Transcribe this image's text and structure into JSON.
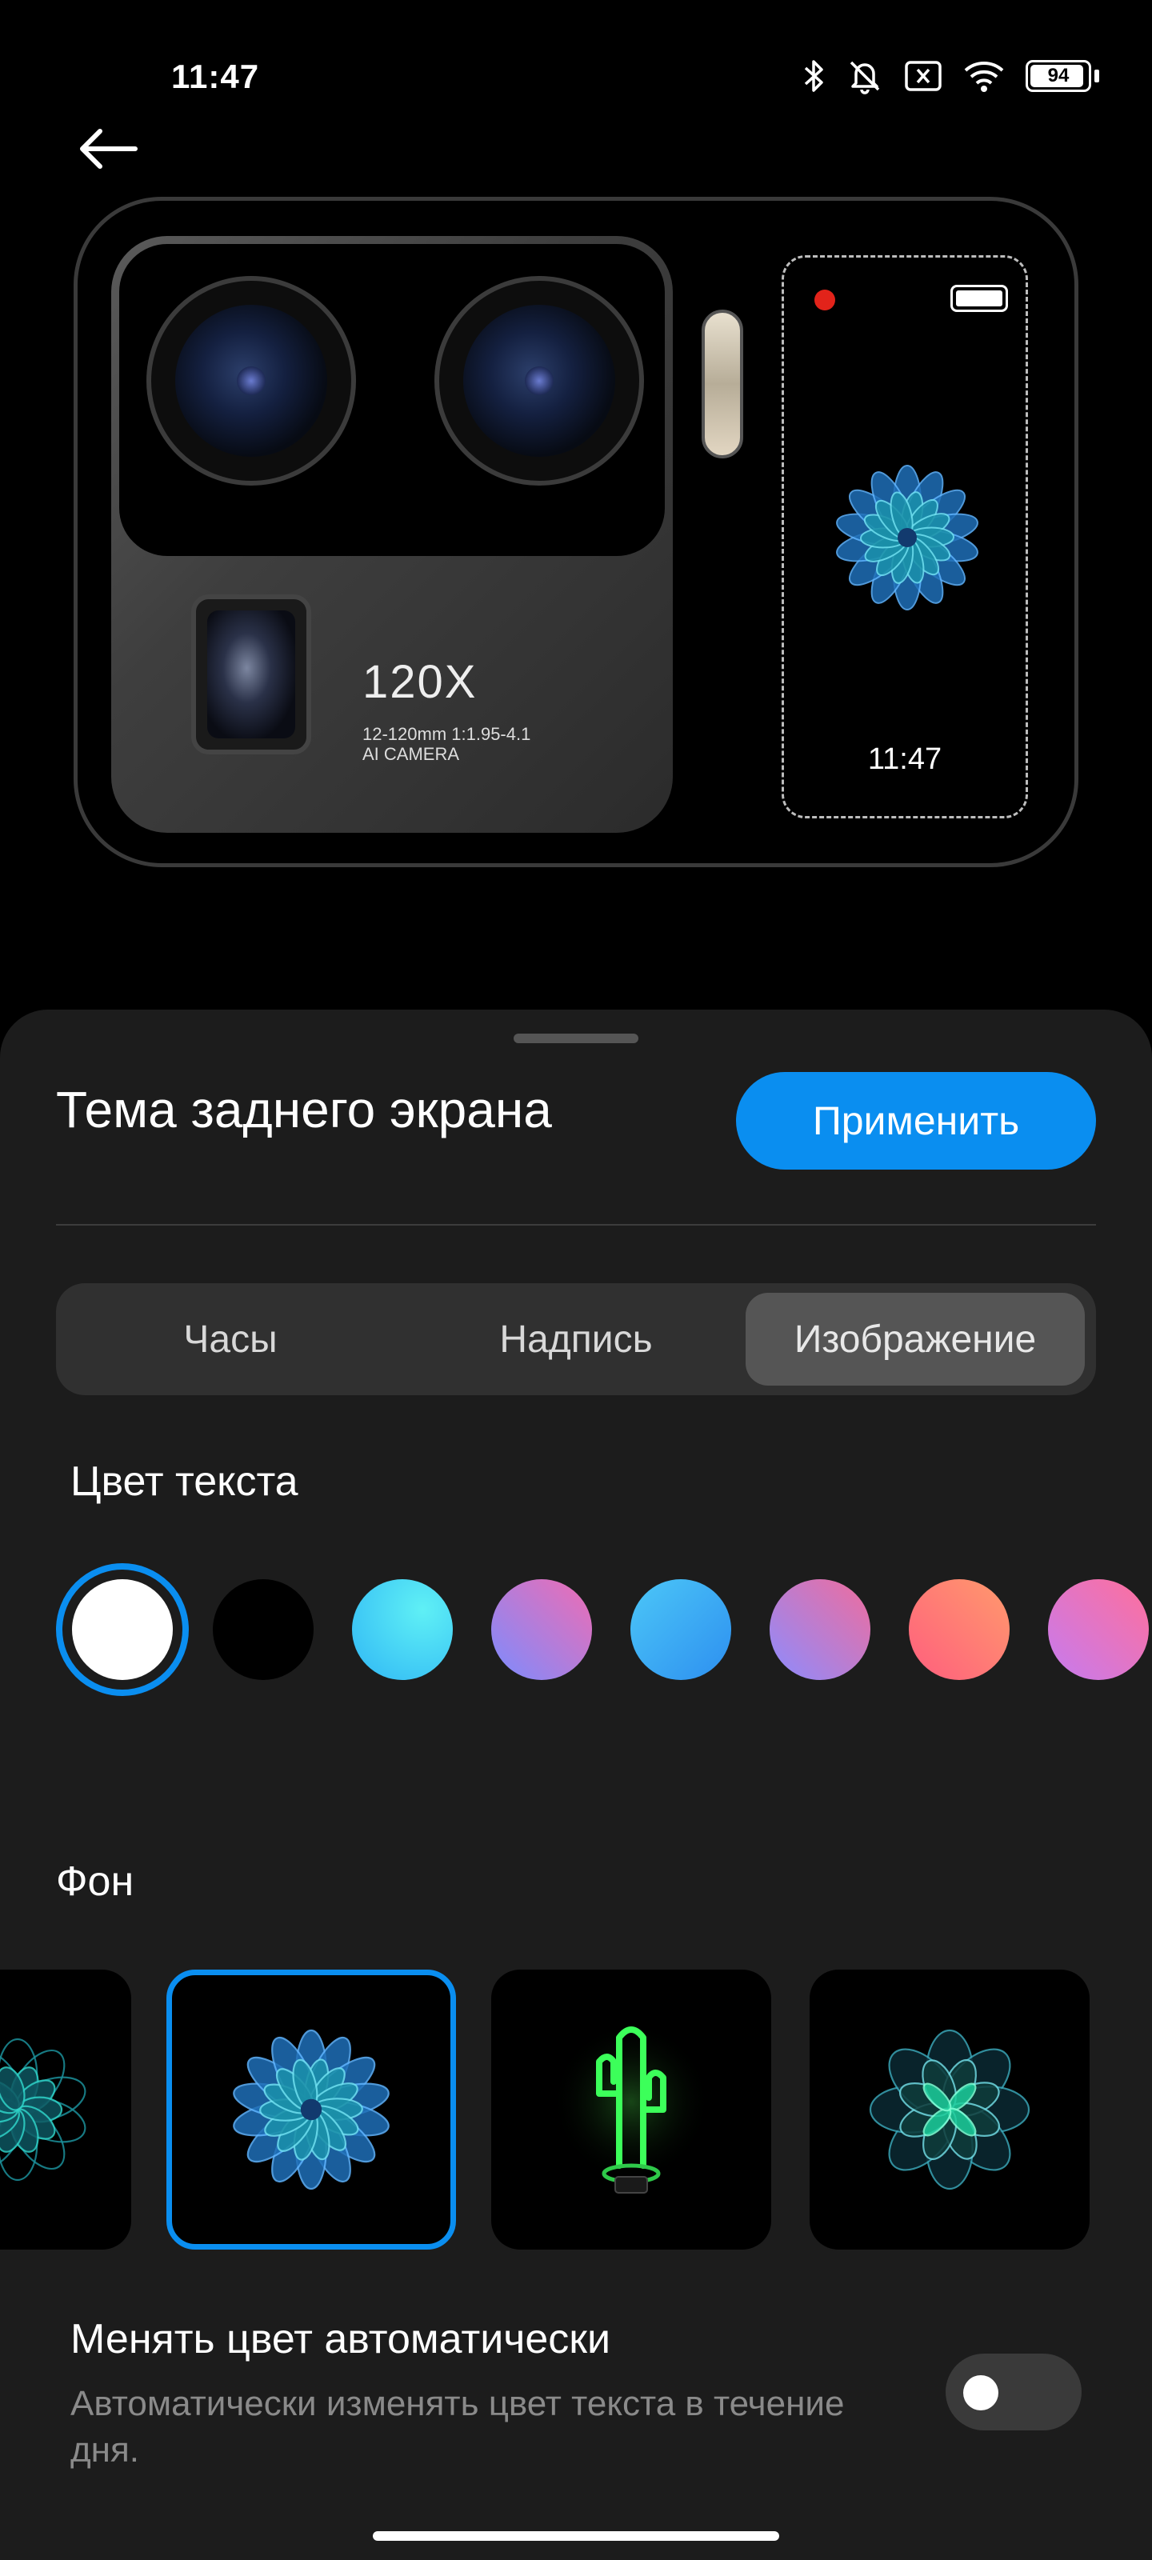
{
  "status_bar": {
    "time": "11:47",
    "icons": [
      "bluetooth-icon",
      "silent-bell-icon",
      "no-sim-icon",
      "wifi-icon",
      "battery-icon"
    ],
    "battery_level": "94",
    "battery_fraction": 0.94
  },
  "preview": {
    "camera_model": "120X",
    "camera_spec_line1": "12-120mm 1:1.95-4.1",
    "camera_spec_line2": "AI CAMERA",
    "rear_screen_time": "11:47"
  },
  "sheet": {
    "title": "Тема заднего экрана",
    "apply_label": "Применить",
    "tabs": [
      {
        "label": "Часы",
        "active": false
      },
      {
        "label": "Надпись",
        "active": false
      },
      {
        "label": "Изображение",
        "active": true
      }
    ],
    "text_color_label": "Цвет текста",
    "text_colors": [
      "#ffffff",
      "#000000",
      "#2fd3f5",
      "#b06ce8",
      "#2fb6f5",
      "#f06cb2",
      "#ff6f6f",
      "#e86ccd"
    ],
    "selected_text_color": "#ffffff",
    "background_label": "Фон",
    "backgrounds": [
      "mandala-teal",
      "flower-blue",
      "neon-cactus",
      "kaleidoscope-teal"
    ],
    "selected_background": "flower-blue",
    "auto_color_title": "Менять цвет автоматически",
    "auto_color_desc": "Автоматически изменять цвет текста в течение дня.",
    "auto_color_enabled": false
  },
  "colors": {
    "accent": "#0a8ef0",
    "sheet_bg": "#1c1c1c"
  }
}
